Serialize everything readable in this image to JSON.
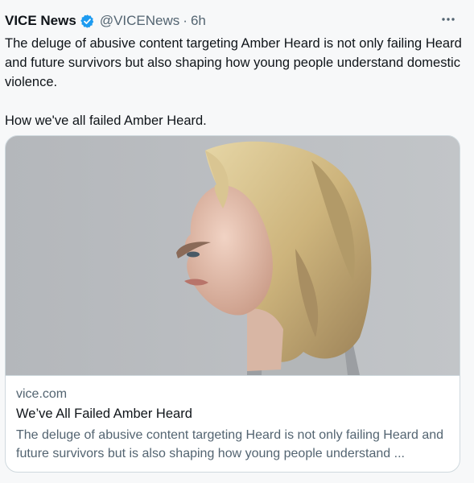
{
  "tweet": {
    "author_name": "VICE News",
    "handle": "@VICENews",
    "separator": "·",
    "time": "6h",
    "text_p1": "The deluge of abusive content targeting Amber Heard is not only failing Heard and future survivors but also shaping how young people understand domestic violence.",
    "text_p2": "How we've all failed Amber Heard."
  },
  "card": {
    "domain": "vice.com",
    "title": "We’ve All Failed Amber Heard",
    "description": "The deluge of abusive content targeting Heard is not only failing Heard and future survivors but is also shaping how young people understand ..."
  },
  "icons": {
    "verified": "verified-badge-icon",
    "more": "more-options-icon"
  },
  "colors": {
    "verified_blue": "#1d9bf0",
    "secondary_text": "#536471",
    "border": "#cfd9de"
  }
}
